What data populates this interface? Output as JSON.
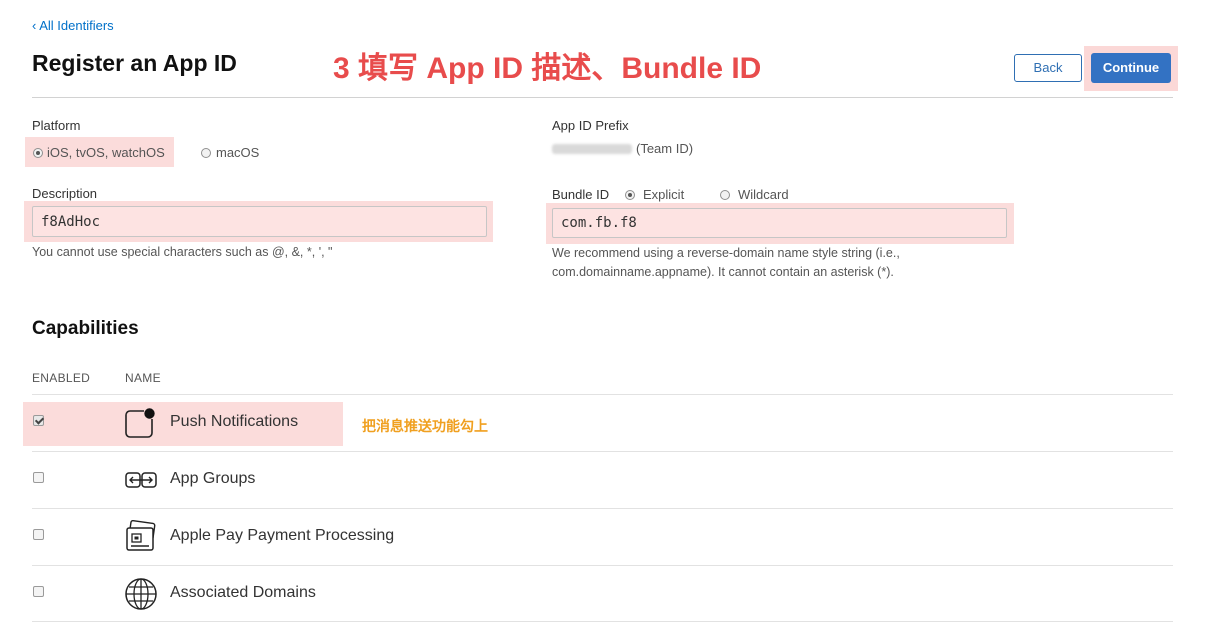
{
  "header": {
    "back_link": "‹ All Identifiers",
    "title": "Register an App ID",
    "annotation": "3 填写 App ID 描述、Bundle ID",
    "back_button": "Back",
    "continue_button": "Continue"
  },
  "platform": {
    "label": "Platform",
    "options": [
      {
        "label": "iOS, tvOS, watchOS",
        "selected": true
      },
      {
        "label": "macOS",
        "selected": false
      }
    ]
  },
  "prefix": {
    "label": "App ID Prefix",
    "value_suffix": "(Team ID)"
  },
  "description": {
    "label": "Description",
    "value": "f8AdHoc",
    "hint": "You cannot use special characters such as @, &, *, ', \""
  },
  "bundle": {
    "label": "Bundle ID",
    "options": [
      {
        "label": "Explicit",
        "selected": true
      },
      {
        "label": "Wildcard",
        "selected": false
      }
    ],
    "value": "com.fb.f8",
    "hint_line1": "We recommend using a reverse-domain name style string (i.e.,",
    "hint_line2": "com.domainname.appname). It cannot contain an asterisk (*)."
  },
  "capabilities": {
    "title": "Capabilities",
    "col_enabled": "ENABLED",
    "col_name": "NAME",
    "annotation": "把消息推送功能勾上",
    "items": [
      {
        "name": "Push Notifications",
        "enabled": true,
        "icon": "push-notifications-icon"
      },
      {
        "name": "App Groups",
        "enabled": false,
        "icon": "app-groups-icon"
      },
      {
        "name": "Apple Pay Payment Processing",
        "enabled": false,
        "icon": "apple-pay-icon"
      },
      {
        "name": "Associated Domains",
        "enabled": false,
        "icon": "globe-icon"
      }
    ]
  },
  "colors": {
    "link": "#0070c9",
    "primary_button": "#3372c3",
    "annotation_red": "#e84c4c",
    "annotation_orange": "#f0a020",
    "highlight": "#fbdcdb"
  }
}
